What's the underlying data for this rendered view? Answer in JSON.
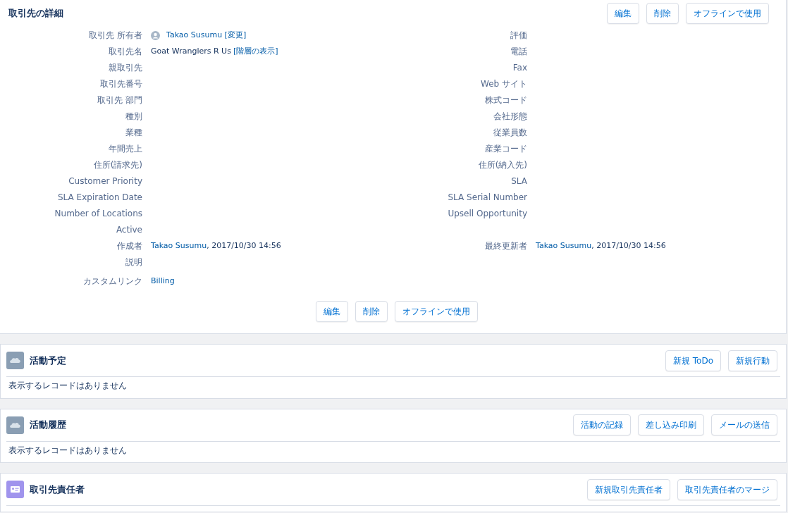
{
  "detail": {
    "title": "取引先の詳細",
    "buttons": [
      "編集",
      "削除",
      "オフラインで使用"
    ],
    "rows": [
      {
        "left": {
          "label": "取引先 所有者",
          "avatar": true,
          "value": [
            {
              "kind": "link",
              "text": "Takao Susumu [変更]"
            }
          ]
        },
        "right": {
          "label": "評価"
        }
      },
      {
        "left": {
          "label": "取引先名",
          "value": [
            {
              "kind": "plain",
              "text": "Goat Wranglers R Us"
            },
            {
              "kind": "link",
              "text": "[階層の表示]"
            }
          ]
        },
        "right": {
          "label": "電話"
        }
      },
      {
        "left": {
          "label": "親取引先"
        },
        "right": {
          "label": "Fax"
        }
      },
      {
        "left": {
          "label": "取引先番号"
        },
        "right": {
          "label": "Web サイト"
        }
      },
      {
        "left": {
          "label": "取引先 部門"
        },
        "right": {
          "label": "株式コード"
        }
      },
      {
        "left": {
          "label": "種別"
        },
        "right": {
          "label": "会社形態"
        }
      },
      {
        "left": {
          "label": "業種"
        },
        "right": {
          "label": "従業員数"
        }
      },
      {
        "left": {
          "label": "年間売上"
        },
        "right": {
          "label": "産業コード"
        }
      },
      {
        "left": {
          "label": "住所(請求先)"
        },
        "right": {
          "label": "住所(納入先)"
        }
      },
      {
        "left": {
          "label": "Customer Priority"
        },
        "right": {
          "label": "SLA"
        }
      },
      {
        "left": {
          "label": "SLA Expiration Date"
        },
        "right": {
          "label": "SLA Serial Number"
        }
      },
      {
        "left": {
          "label": "Number of Locations"
        },
        "right": {
          "label": "Upsell Opportunity"
        }
      },
      {
        "left": {
          "label": "Active"
        }
      },
      {
        "left": {
          "label": "作成者",
          "value": [
            {
              "kind": "link",
              "text": "Takao Susumu"
            },
            {
              "kind": "plain",
              "text": ", 2017/10/30 14:56"
            }
          ]
        },
        "right": {
          "label": "最終更新者",
          "value": [
            {
              "kind": "link",
              "text": "Takao Susumu"
            },
            {
              "kind": "plain",
              "text": ", 2017/10/30 14:56"
            }
          ]
        }
      },
      {
        "left": {
          "label": "説明"
        }
      },
      {
        "left": {
          "label": "カスタムリンク",
          "value": [
            {
              "kind": "link",
              "text": "Billing"
            }
          ]
        }
      }
    ],
    "bottom_buttons": [
      "編集",
      "削除",
      "オフラインで使用"
    ]
  },
  "related_lists": [
    {
      "kind": "activity",
      "title": "活動予定",
      "buttons": [
        "新規 ToDo",
        "新規行動"
      ],
      "message": "表示するレコードはありません"
    },
    {
      "kind": "activity",
      "title": "活動履歴",
      "buttons": [
        "活動の記録",
        "差し込み印刷",
        "メールの送信"
      ],
      "message": "表示するレコードはありません"
    },
    {
      "kind": "contact",
      "title": "取引先責任者",
      "buttons": [
        "新規取引先責任者",
        "取引先責任者のマージ"
      ]
    }
  ]
}
